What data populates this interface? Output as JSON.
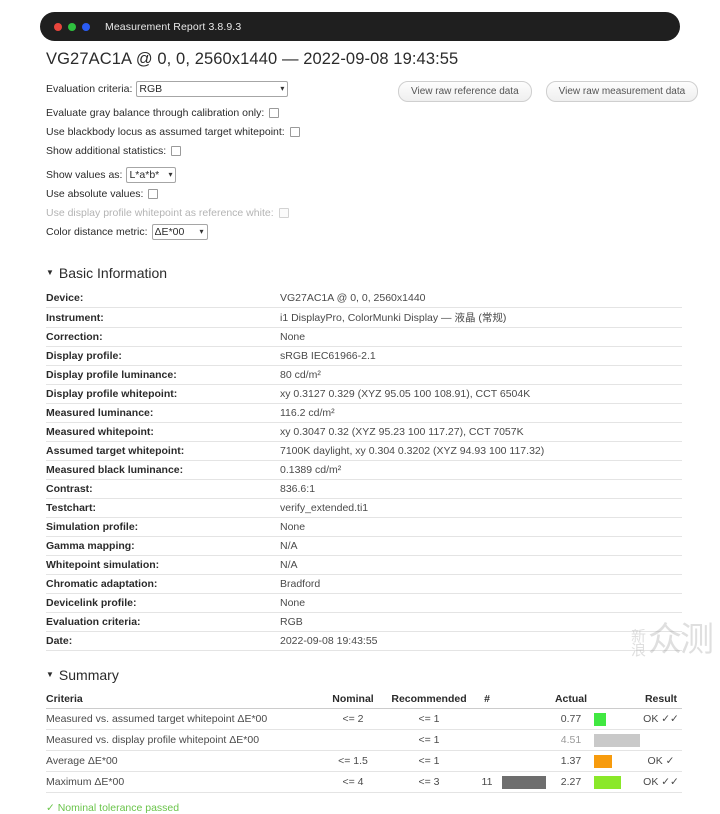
{
  "window": {
    "title": "Measurement Report 3.8.9.3",
    "dots": [
      "red",
      "green",
      "blue"
    ],
    "colors": {
      "red": "#e8453c",
      "green": "#2fc13f",
      "blue": "#2a5cf5",
      "bar": "#1f1f1f"
    }
  },
  "report": {
    "title": "VG27AC1A @ 0, 0, 2560x1440 — 2022-09-08 19:43:55"
  },
  "options": {
    "evaluation_criteria_label": "Evaluation criteria:",
    "evaluation_criteria_value": "RGB",
    "gray_balance_label": "Evaluate gray balance through calibration only:",
    "blackbody_label": "Use blackbody locus as assumed target whitepoint:",
    "additional_stats_label": "Show additional statistics:",
    "show_values_label": "Show values as:",
    "show_values_value": "L*a*b*",
    "absolute_values_label": "Use absolute values:",
    "profile_whitepoint_label": "Use display profile whitepoint as reference white:",
    "color_distance_label": "Color distance metric:",
    "color_distance_value": "ΔE*00"
  },
  "buttons": {
    "view_raw_reference": "View raw reference data",
    "view_raw_measurement": "View raw measurement data"
  },
  "basic_information": {
    "heading": "Basic Information",
    "rows": [
      {
        "key": "Device:",
        "value": "VG27AC1A @ 0, 0, 2560x1440"
      },
      {
        "key": "Instrument:",
        "value": "i1 DisplayPro, ColorMunki Display — 液晶 (常规)"
      },
      {
        "key": "Correction:",
        "value": "None"
      },
      {
        "key": "Display profile:",
        "value": "sRGB IEC61966-2.1"
      },
      {
        "key": "Display profile luminance:",
        "value": "80 cd/m²"
      },
      {
        "key": "Display profile whitepoint:",
        "value": "xy 0.3127 0.329 (XYZ 95.05 100 108.91), CCT 6504K"
      },
      {
        "key": "Measured luminance:",
        "value": "116.2 cd/m²"
      },
      {
        "key": "Measured whitepoint:",
        "value": "xy 0.3047 0.32 (XYZ 95.23 100 117.27), CCT 7057K"
      },
      {
        "key": "Assumed target whitepoint:",
        "value": "7100K daylight, xy 0.304 0.3202 (XYZ 94.93 100 117.32)"
      },
      {
        "key": "Measured black luminance:",
        "value": "0.1389 cd/m²"
      },
      {
        "key": "Contrast:",
        "value": "836.6:1"
      },
      {
        "key": "Testchart:",
        "value": "verify_extended.ti1"
      },
      {
        "key": "Simulation profile:",
        "value": "None"
      },
      {
        "key": "Gamma mapping:",
        "value": "N/A"
      },
      {
        "key": "Whitepoint simulation:",
        "value": "N/A"
      },
      {
        "key": "Chromatic adaptation:",
        "value": "Bradford"
      },
      {
        "key": "Devicelink profile:",
        "value": "None"
      },
      {
        "key": "Evaluation criteria:",
        "value": "RGB"
      },
      {
        "key": "Date:",
        "value": "2022-09-08 19:43:55"
      }
    ]
  },
  "summary": {
    "heading": "Summary",
    "headers": [
      "Criteria",
      "Nominal",
      "Recommended",
      "#",
      "Actual",
      "Result"
    ],
    "rows": [
      {
        "criteria": "Measured vs. assumed target whitepoint ΔE*00",
        "nominal": "<= 2",
        "recommended": "<= 1",
        "count": "",
        "count_bar_pct": 0,
        "count_bar_color": "",
        "actual": "0.77",
        "actual_muted": false,
        "bar_pct": 26,
        "bar_color": "#41e841",
        "result": "OK ✓✓"
      },
      {
        "criteria": "Measured vs. display profile whitepoint ΔE*00",
        "nominal": "",
        "recommended": "<= 1",
        "count": "",
        "count_bar_pct": 0,
        "count_bar_color": "",
        "actual": "4.51",
        "actual_muted": true,
        "bar_pct": 100,
        "bar_color": "#c9c9c9",
        "result": ""
      },
      {
        "criteria": "Average ΔE*00",
        "nominal": "<= 1.5",
        "recommended": "<= 1",
        "count": "",
        "count_bar_pct": 0,
        "count_bar_color": "",
        "actual": "1.37",
        "actual_muted": false,
        "bar_pct": 40,
        "bar_color": "#f79b0d",
        "result": "OK ✓"
      },
      {
        "criteria": "Maximum ΔE*00",
        "nominal": "<= 4",
        "recommended": "<= 3",
        "count": "11",
        "count_bar_pct": 96,
        "count_bar_color": "#6e6e6e",
        "actual": "2.27",
        "actual_muted": false,
        "bar_pct": 58,
        "bar_color": "#8ae829",
        "result": "OK ✓✓"
      }
    ],
    "pass_note": "✓ Nominal tolerance passed"
  },
  "watermark": {
    "small": "新浪",
    "big": "众测"
  }
}
